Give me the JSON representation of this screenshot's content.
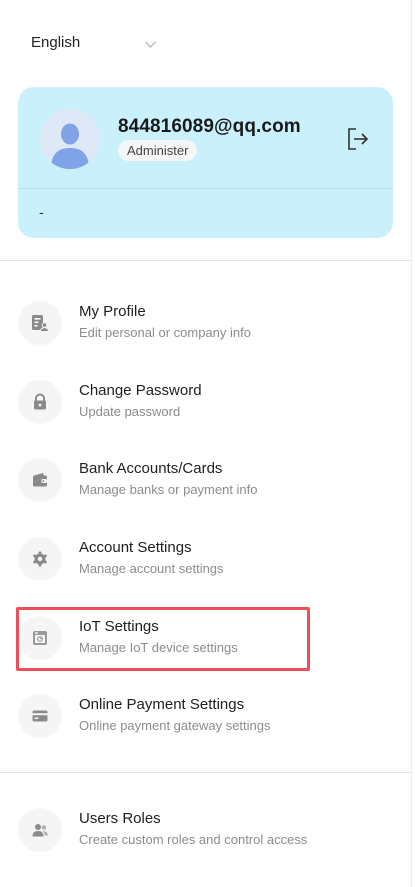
{
  "language": {
    "selected": "English"
  },
  "profile": {
    "email": "844816089@qq.com",
    "role": "Administer",
    "footer": "-"
  },
  "menu": [
    {
      "title": "My Profile",
      "subtitle": "Edit personal or company info",
      "icon": "profile-card-icon"
    },
    {
      "title": "Change Password",
      "subtitle": "Update password",
      "icon": "lock-icon"
    },
    {
      "title": "Bank Accounts/Cards",
      "subtitle": "Manage banks or payment info",
      "icon": "wallet-icon"
    },
    {
      "title": "Account Settings",
      "subtitle": "Manage account settings",
      "icon": "gear-icon"
    },
    {
      "title": "IoT Settings",
      "subtitle": "Manage IoT device settings",
      "icon": "iot-device-icon"
    },
    {
      "title": "Online Payment Settings",
      "subtitle": "Online payment gateway settings",
      "icon": "credit-card-icon"
    },
    {
      "title": "Users Roles",
      "subtitle": "Create custom roles and control access",
      "icon": "users-icon"
    }
  ],
  "colors": {
    "card_background": "#c9f0fb",
    "highlight_border": "#ee4e57",
    "icon_gray": "#8a8a8a"
  }
}
